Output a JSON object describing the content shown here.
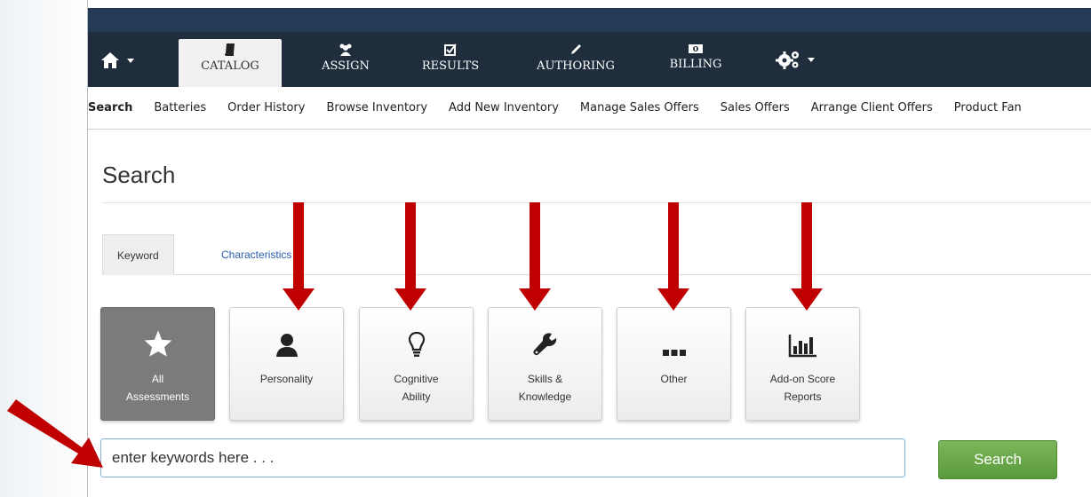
{
  "main_nav": {
    "tabs": [
      {
        "label": "CATALOG",
        "icon": "book-icon",
        "active": true
      },
      {
        "label": "ASSIGN",
        "icon": "users-icon"
      },
      {
        "label": "RESULTS",
        "icon": "checkbox-icon"
      },
      {
        "label": "AUTHORING",
        "icon": "pencil-icon"
      },
      {
        "label": "BILLING",
        "icon": "money-icon"
      }
    ]
  },
  "subnav": {
    "items": [
      {
        "label": "Search",
        "active": true
      },
      {
        "label": "Batteries"
      },
      {
        "label": "Order History"
      },
      {
        "label": "Browse Inventory"
      },
      {
        "label": "Add New Inventory"
      },
      {
        "label": "Manage Sales Offers"
      },
      {
        "label": "Sales Offers"
      },
      {
        "label": "Arrange Client Offers"
      },
      {
        "label": "Product Fan"
      }
    ]
  },
  "page": {
    "title": "Search",
    "tabs": {
      "keyword": "Keyword",
      "characteristics": "Characteristics"
    }
  },
  "categories": [
    {
      "label": "All\nAssessments",
      "icon": "star-icon",
      "selected": true
    },
    {
      "label": "Personality",
      "icon": "person-icon"
    },
    {
      "label": "Cognitive\nAbility",
      "icon": "lightbulb-icon"
    },
    {
      "label": "Skills &\nKnowledge",
      "icon": "wrench-icon"
    },
    {
      "label": "Other",
      "icon": "ellipsis-icon"
    },
    {
      "label": "Add-on Score\nReports",
      "icon": "bar-chart-icon"
    }
  ],
  "search": {
    "placeholder": "enter keywords here . . .",
    "button_label": "Search"
  },
  "colors": {
    "nav_bg": "#1f2d3c",
    "title_bar": "#253a55",
    "annotation_arrow": "#c00000",
    "search_button": "#6aa84f",
    "link": "#2a5db0"
  }
}
